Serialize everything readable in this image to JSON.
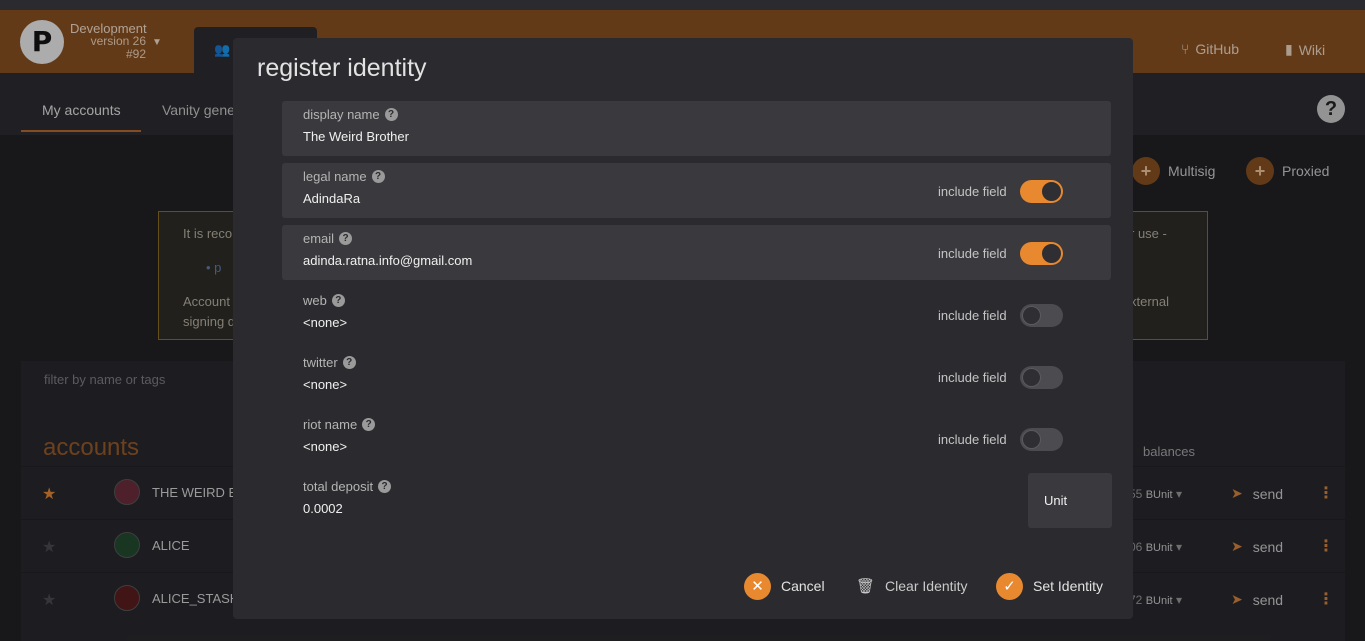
{
  "header": {
    "chain_name": "Development",
    "chain_version": "version 26",
    "chain_block": "#92",
    "links": [
      "GitHub",
      "Wiki"
    ]
  },
  "subnav": {
    "tabs": [
      "My accounts",
      "Vanity gene"
    ]
  },
  "toolbar": {
    "multisig": "Multisig",
    "proxied": "Proxied"
  },
  "warning": {
    "line1_start": "It is reco",
    "line1_end": "r use -",
    "bullet": "p",
    "line2_start": "Account",
    "line2_end": "xternal",
    "line3_start": "signing d"
  },
  "accounts": {
    "filter_placeholder": "filter by name or tags",
    "title": "accounts",
    "balances_header": "balances",
    "rows": [
      {
        "name": "THE WEIRD B",
        "balance": "55",
        "unit": "BUnit",
        "action": "send",
        "starred": true
      },
      {
        "name": "ALICE",
        "balance": "06",
        "unit": "BUnit",
        "action": "send",
        "starred": false
      },
      {
        "name": "ALICE_STASH",
        "balance": "72",
        "unit": "BUnit",
        "action": "send",
        "starred": false
      }
    ]
  },
  "modal": {
    "title": "register identity",
    "fields": [
      {
        "label": "display name",
        "value": "The Weird Brother",
        "filled": true,
        "toggle": null
      },
      {
        "label": "legal name",
        "value": "AdindaRa",
        "filled": true,
        "toggle": true
      },
      {
        "label": "email",
        "value": "adinda.ratna.info@gmail.com",
        "filled": true,
        "toggle": true
      },
      {
        "label": "web",
        "value": "<none>",
        "filled": false,
        "toggle": false
      },
      {
        "label": "twitter",
        "value": "<none>",
        "filled": false,
        "toggle": false
      },
      {
        "label": "riot name",
        "value": "<none>",
        "filled": false,
        "toggle": false
      }
    ],
    "include_field_label": "include field",
    "deposit_label": "total deposit",
    "deposit_value": "0.0002",
    "unit": "Unit",
    "cancel": "Cancel",
    "clear": "Clear Identity",
    "set": "Set Identity"
  },
  "colors": {
    "accent": "#e8892f",
    "header": "#8a4f1c",
    "modal_bg": "#2b2b2f"
  }
}
